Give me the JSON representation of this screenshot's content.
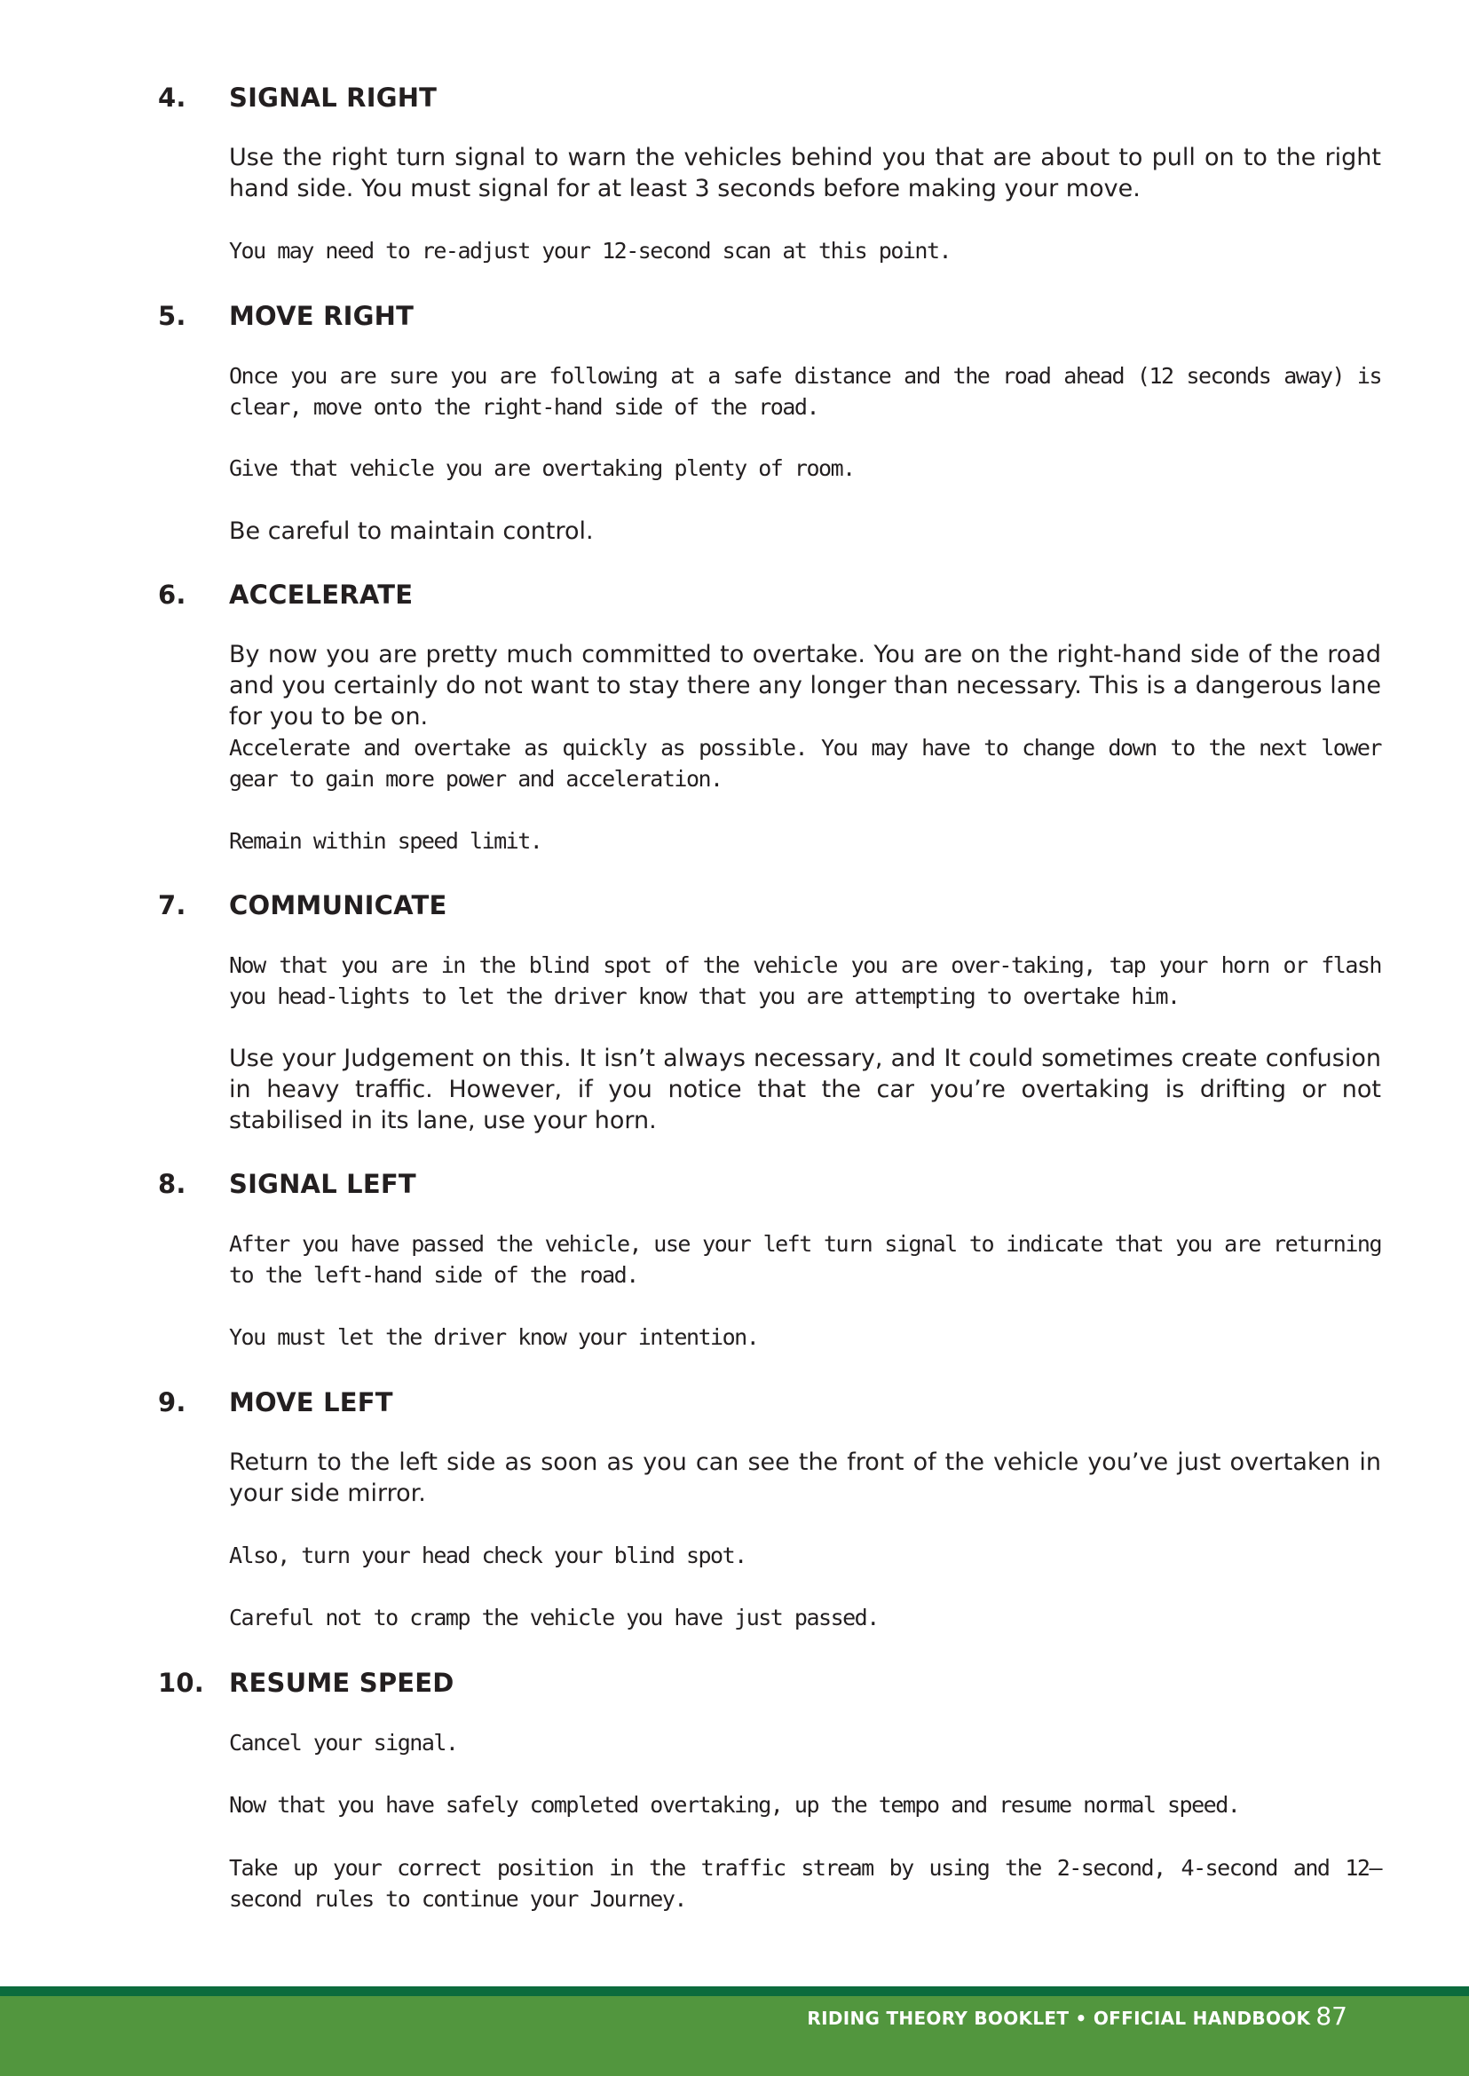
{
  "sections": [
    {
      "number": "4.",
      "title": "SIGNAL RIGHT",
      "paragraphs": [
        "Use the right turn signal to warn the vehicles behind you that are about to pull on to the right hand side. You must signal for at least 3 seconds before making your move.",
        "You may need to re-adjust your 12-second scan at this point."
      ]
    },
    {
      "number": "5.",
      "title": "MOVE RIGHT",
      "paragraphs": [
        "Once you are sure you are following at a safe distance and the road ahead (12 seconds away) is clear, move onto the right-hand side of the road.",
        "Give that vehicle you are overtaking plenty of room.",
        "Be careful to maintain control."
      ]
    },
    {
      "number": "6.",
      "title": "ACCELERATE",
      "paragraphs": [
        "By now you are pretty much committed to overtake. You are on the right-hand side of the road and you certainly do not want to stay there any longer than necessary. This is a dangerous lane for you to be on.",
        "Accelerate and overtake as quickly as possible. You may have to change down to the next lower gear to gain more power and acceleration.",
        "Remain within speed limit."
      ]
    },
    {
      "number": "7.",
      "title": "COMMUNICATE",
      "paragraphs": [
        "Now that you are in the blind spot of the vehicle you are over-taking, tap your horn or flash you head-lights to let the driver know that you are attempting to overtake him.",
        "Use your Judgement on this. It isn’t always necessary, and It could sometimes create confusion in heavy traffic. However, if you notice that the car you’re overtaking is drifting or not stabilised in its lane, use your horn."
      ]
    },
    {
      "number": "8.",
      "title": "SIGNAL LEFT",
      "paragraphs": [
        "After you have passed the vehicle, use your left turn signal to indicate that you are returning to the left-hand side of the road.",
        "You must let the driver know your intention."
      ]
    },
    {
      "number": "9.",
      "title": "MOVE LEFT",
      "paragraphs": [
        "Return to the left side as soon as you can see the front of the vehicle you’ve just overtaken in your side mirror.",
        "Also, turn your head check your blind spot.",
        "Careful not to cramp the vehicle you have just passed."
      ]
    },
    {
      "number": "10.",
      "title": "RESUME SPEED",
      "paragraphs": [
        "Cancel your signal.",
        "Now that you have safely completed overtaking, up the tempo and resume normal speed.",
        "Take up your correct position in the traffic stream by using the 2-second, 4-second and 12—second rules to continue your Journey."
      ]
    }
  ],
  "footer": {
    "title": "RIDING THEORY BOOKLET • OFFICIAL HANDBOOK",
    "page_number": "87"
  },
  "colors": {
    "footer_band": "#52963e",
    "footer_rule": "#0c6b3d",
    "text": "#231f20"
  }
}
